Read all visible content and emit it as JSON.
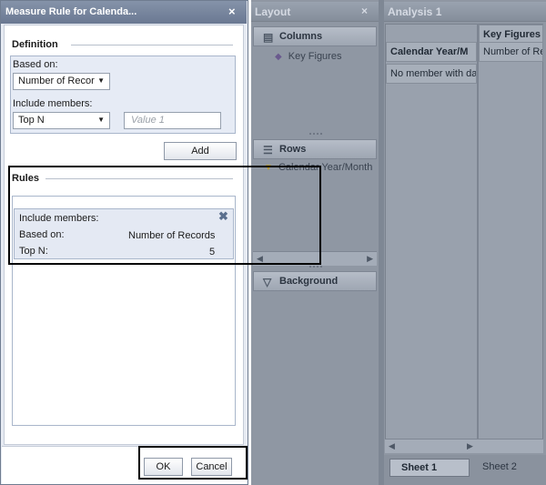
{
  "layout_panel": {
    "title": "Layout",
    "close": "×",
    "columns": {
      "title": "Columns",
      "item": "Key Figures"
    },
    "rows": {
      "title": "Rows",
      "item": "Calendar Year/Month"
    },
    "background": {
      "title": "Background"
    }
  },
  "analysis": {
    "title": "Analysis 1",
    "grid": {
      "col1_header": "Calendar Year/M",
      "col2_header": "Key Figures",
      "col2_sub": "Number of Re",
      "row1": "No member with da"
    },
    "sheets": [
      "Sheet 1",
      "Sheet 2"
    ]
  },
  "dialog": {
    "title": "Measure Rule for Calenda...",
    "close": "×",
    "definition": {
      "legend": "Definition",
      "based_on_label": "Based on:",
      "based_on_value": "Number of Recor",
      "include_label": "Include members:",
      "include_value": "Top N",
      "value_placeholder": "Value 1",
      "add_label": "Add"
    },
    "rules": {
      "legend": "Rules",
      "card": {
        "include_label": "Include members:",
        "based_on_label": "Based on:",
        "based_on_value": "Number of Records",
        "topn_label": "Top N:",
        "topn_value": "5",
        "remove": "✖"
      }
    },
    "footer": {
      "ok": "OK",
      "cancel": "Cancel"
    }
  },
  "icons": {
    "columns": "columns-icon",
    "rows": "rows-icon",
    "background": "filter-icon",
    "key_figures": "measure-icon",
    "dimension": "dimension-icon"
  },
  "colors": {
    "dialog_title": "#6a7892",
    "panel_bg": "#8f97a3",
    "definition_bg": "#e6ebf5"
  }
}
